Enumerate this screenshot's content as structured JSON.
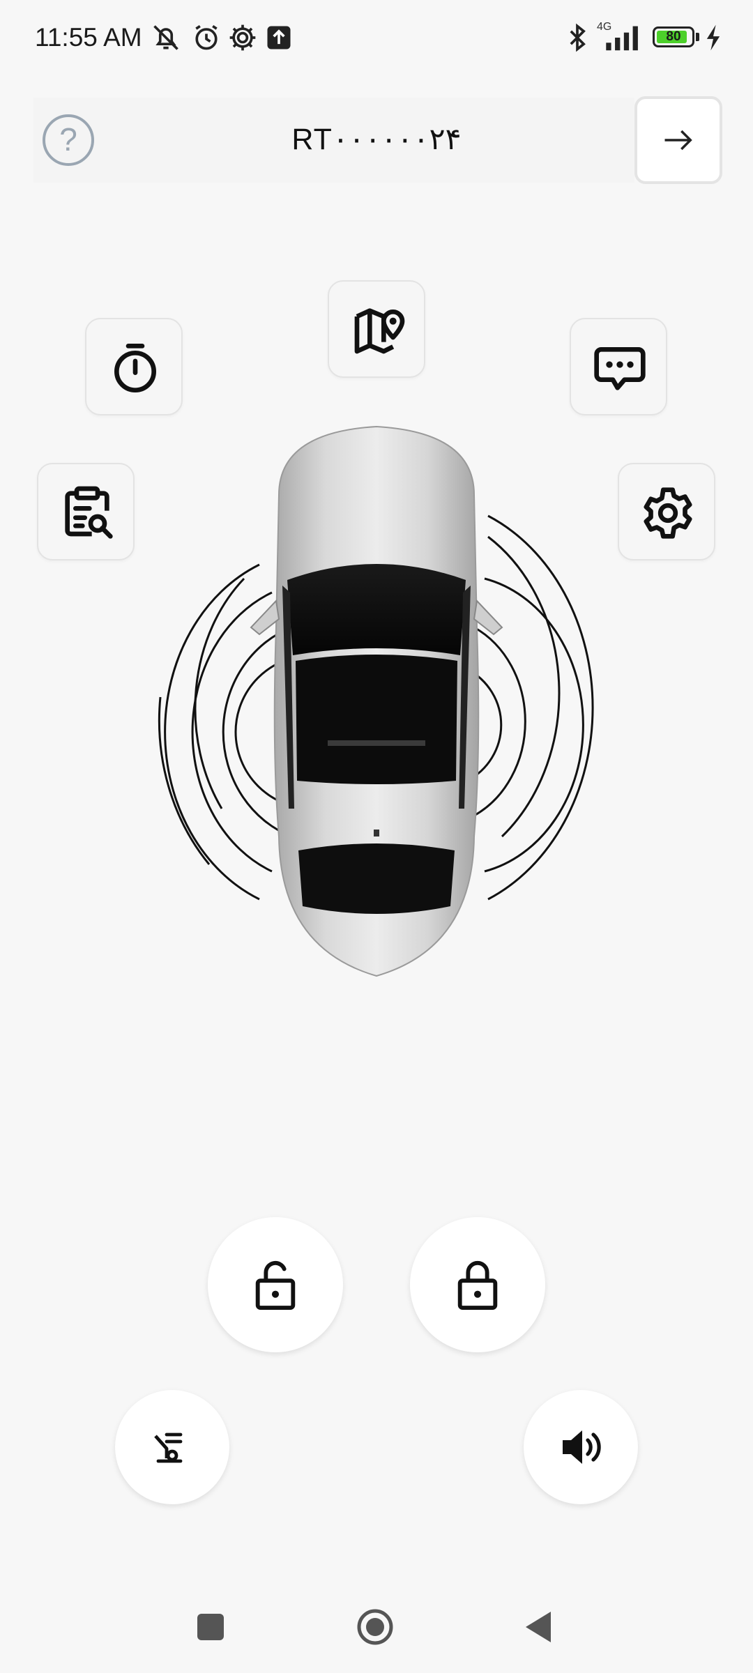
{
  "status_bar": {
    "time": "11:55 AM",
    "network": "4G",
    "battery_level": "80",
    "icons": [
      "muted-bell-icon",
      "alarm-icon",
      "gear-icon",
      "upload-icon",
      "bluetooth-icon",
      "signal-icon",
      "battery-icon",
      "charging-icon"
    ]
  },
  "header": {
    "help_icon": "?",
    "title": "RT۰۰۰۰۰۰۲۴",
    "forward_icon": "arrow-right-icon"
  },
  "tiles": [
    {
      "name": "map-location-icon"
    },
    {
      "name": "timer-icon"
    },
    {
      "name": "message-icon"
    },
    {
      "name": "report-search-icon"
    },
    {
      "name": "settings-icon"
    }
  ],
  "controls": {
    "unlock": "unlock-icon",
    "lock": "lock-icon",
    "trunk": "trunk-icon",
    "horn": "speaker-icon"
  },
  "colors": {
    "background": "#f7f7f7",
    "help_icon": "#9aa6b2",
    "battery_fill": "#4cd02a",
    "icon": "#111111"
  }
}
